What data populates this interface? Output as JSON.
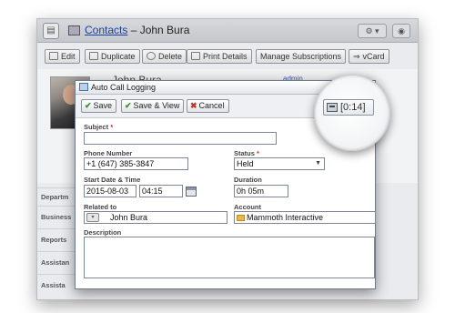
{
  "header": {
    "title_link": "Contacts",
    "title_rest": " – John Bura",
    "record_icon": "contact-card-icon",
    "settings_icon": "gear-icon",
    "help_icon": "help-icon"
  },
  "toolbar": {
    "edit": "Edit",
    "duplicate": "Duplicate",
    "delete": "Delete",
    "print": "Print Details",
    "subscriptions": "Manage Subscriptions",
    "vcard": "vCard"
  },
  "record": {
    "name": "John Bura",
    "owner": "admin",
    "side_labels": [
      "Departm",
      "Business",
      "Reports",
      "Assistan",
      "Assista"
    ]
  },
  "dialog": {
    "title": "Auto Call Logging",
    "buttons": {
      "save": "Save",
      "save_view": "Save & View",
      "cancel": "Cancel"
    },
    "timer": "[0:14]",
    "subject_label": "Subject",
    "subject_value": "",
    "phone_label": "Phone Number",
    "phone_value": "+1 (647) 385-3847",
    "status_label": "Status",
    "status_value": "Held",
    "start_label": "Start Date & Time",
    "start_date": "2015-08-03",
    "start_time": "04:15",
    "duration_label": "Duration",
    "duration_value": "0h 05m",
    "related_label": "Related to",
    "related_value": "John Bura",
    "account_label": "Account",
    "account_value": "Mammoth Interactive",
    "description_label": "Description",
    "description_value": ""
  }
}
